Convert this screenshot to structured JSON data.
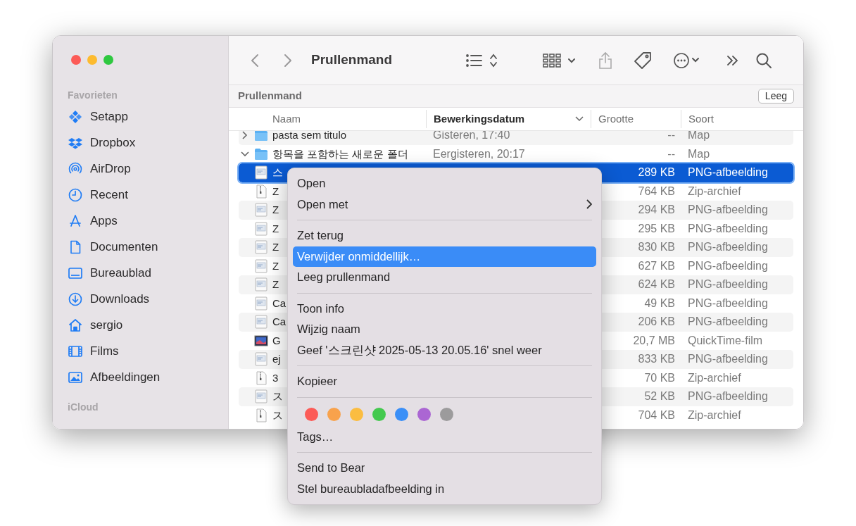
{
  "window": {
    "title": "Prullenmand"
  },
  "sidebar": {
    "sections": [
      {
        "heading": "Favorieten",
        "items": [
          {
            "label": "Setapp",
            "selected": false
          },
          {
            "label": "Dropbox",
            "selected": false
          },
          {
            "label": "AirDrop",
            "selected": false
          },
          {
            "label": "Recent",
            "selected": false
          },
          {
            "label": "Apps",
            "selected": false
          },
          {
            "label": "Documenten",
            "selected": false
          },
          {
            "label": "Bureaublad",
            "selected": false
          },
          {
            "label": "Downloads",
            "selected": false
          },
          {
            "label": "sergio",
            "selected": false
          },
          {
            "label": "Films",
            "selected": false
          },
          {
            "label": "Afbeeldingen",
            "selected": false
          }
        ]
      },
      {
        "heading": "iCloud"
      }
    ]
  },
  "path_bar": {
    "title": "Prullenmand",
    "button": "Leeg"
  },
  "table": {
    "columns": [
      {
        "label": "Naam",
        "sorted": false
      },
      {
        "label": "Bewerkingsdatum",
        "sorted": true
      },
      {
        "label": "Grootte",
        "sorted": false
      },
      {
        "label": "Soort",
        "sorted": false
      }
    ],
    "rows": [
      {
        "kind": "folder",
        "expanded": false,
        "name": "pasta sem titulo",
        "date": "Gisteren, 17:40",
        "size": "--",
        "type": "Map",
        "selected": false
      },
      {
        "kind": "folder",
        "expanded": true,
        "name": "항목을 포함하는 새로운 폴더",
        "date": "Eergisteren, 20:17",
        "size": "--",
        "type": "Map",
        "selected": false
      },
      {
        "kind": "png",
        "name": "스",
        "size": "289 KB",
        "type": "PNG-afbeelding",
        "selected": true
      },
      {
        "kind": "zip",
        "name": "Z",
        "size": "764 KB",
        "type": "Zip-archief",
        "selected": false
      },
      {
        "kind": "png",
        "name": "Z",
        "size": "294 KB",
        "type": "PNG-afbeelding",
        "selected": false
      },
      {
        "kind": "png",
        "name": "Z",
        "size": "295 KB",
        "type": "PNG-afbeelding",
        "selected": false
      },
      {
        "kind": "png",
        "name": "Z",
        "size": "830 KB",
        "type": "PNG-afbeelding",
        "selected": false
      },
      {
        "kind": "png",
        "name": "Z",
        "size": "627 KB",
        "type": "PNG-afbeelding",
        "selected": false
      },
      {
        "kind": "png",
        "name": "Z",
        "size": "624 KB",
        "type": "PNG-afbeelding",
        "selected": false
      },
      {
        "kind": "png",
        "name": "Ca",
        "size": "49 KB",
        "type": "PNG-afbeelding",
        "selected": false
      },
      {
        "kind": "png",
        "name": "Ca",
        "size": "206 KB",
        "type": "PNG-afbeelding",
        "selected": false
      },
      {
        "kind": "movie",
        "name": "G",
        "size": "20,7 MB",
        "type": "QuickTime-film",
        "selected": false
      },
      {
        "kind": "png",
        "name": "ej",
        "size": "833 KB",
        "type": "PNG-afbeelding",
        "selected": false
      },
      {
        "kind": "zip",
        "name": "3",
        "size": "70 KB",
        "type": "Zip-archief",
        "selected": false
      },
      {
        "kind": "png",
        "name": "ス",
        "size": "52 KB",
        "type": "PNG-afbeelding",
        "selected": false
      },
      {
        "kind": "zip",
        "name": "ス",
        "size": "704 KB",
        "type": "Zip-archief",
        "selected": false
      }
    ]
  },
  "context_menu": {
    "items": [
      {
        "kind": "item",
        "label": "Open",
        "submenu": false,
        "selected": false
      },
      {
        "kind": "item",
        "label": "Open met",
        "submenu": true,
        "selected": false
      },
      {
        "kind": "separator"
      },
      {
        "kind": "item",
        "label": "Zet terug",
        "submenu": false,
        "selected": false
      },
      {
        "kind": "item",
        "label": "Verwijder onmiddellijk…",
        "submenu": false,
        "selected": true
      },
      {
        "kind": "item",
        "label": "Leeg prullenmand",
        "submenu": false,
        "selected": false
      },
      {
        "kind": "separator"
      },
      {
        "kind": "item",
        "label": "Toon info",
        "submenu": false,
        "selected": false
      },
      {
        "kind": "item",
        "label": "Wijzig naam",
        "submenu": false,
        "selected": false
      },
      {
        "kind": "item",
        "label": "Geef '스크린샷 2025-05-13 20.05.16' snel weer",
        "submenu": false,
        "selected": false
      },
      {
        "kind": "separator"
      },
      {
        "kind": "item",
        "label": "Kopieer",
        "submenu": false,
        "selected": false
      },
      {
        "kind": "separator"
      },
      {
        "kind": "colors",
        "colors": [
          {
            "color": "#fc5b57"
          },
          {
            "color": "#f8a24c"
          },
          {
            "color": "#fbbd41"
          },
          {
            "color": "#44c94f"
          },
          {
            "color": "#3b8ff7"
          },
          {
            "color": "#ab66d3"
          },
          {
            "color": "#9c9b9c"
          }
        ]
      },
      {
        "kind": "item",
        "label": "Tags…",
        "submenu": false,
        "selected": false
      },
      {
        "kind": "separator"
      },
      {
        "kind": "item",
        "label": "Send to Bear",
        "submenu": false,
        "selected": false
      },
      {
        "kind": "item",
        "label": "Stel bureaubladafbeelding in",
        "submenu": false,
        "selected": false
      }
    ]
  }
}
